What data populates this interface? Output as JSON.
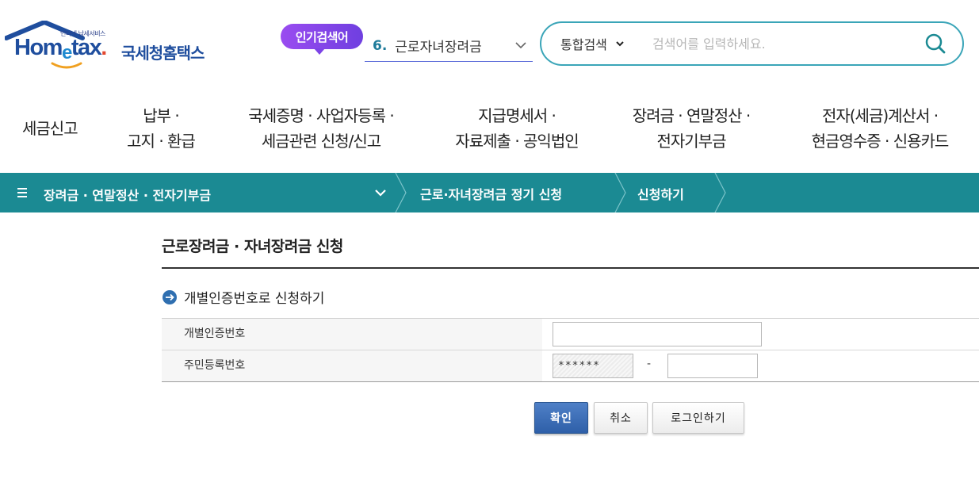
{
  "header": {
    "logo": {
      "tagline": "인터넷 납세서비스",
      "brand_prefix": "Hom",
      "brand_e": "e",
      "brand_suffix": "tax",
      "brand_dot": ".",
      "agency": "국세청홈택스"
    },
    "popular_badge": "인기검색어",
    "popular_rank": {
      "number": "6.",
      "term": "근로자녀장려금"
    },
    "search": {
      "scope": "통합검색",
      "placeholder": "검색어를 입력하세요."
    }
  },
  "gnb": [
    {
      "line1": "세금신고",
      "line2": ""
    },
    {
      "line1": "납부 ·",
      "line2": "고지 · 환급"
    },
    {
      "line1": "국세증명 · 사업자등록 ·",
      "line2": "세금관련 신청/신고"
    },
    {
      "line1": "지급명세서 ·",
      "line2": "자료제출 · 공익법인"
    },
    {
      "line1": "장려금 · 연말정산 ·",
      "line2": "전자기부금"
    },
    {
      "line1": "전자(세금)계산서 ·",
      "line2": "현금영수증 · 신용카드"
    }
  ],
  "breadcrumb": {
    "level1": "장려금 · 연말정산 · 전자기부금",
    "level2": "근로·자녀장려금 정기 신청",
    "level3": "신청하기"
  },
  "main": {
    "page_title": "근로장려금 · 자녀장려금 신청",
    "section_title": "개별인증번호로 신청하기",
    "form": {
      "auth_label": "개별인증번호",
      "auth_value": "",
      "rrn_label": "주민등록번호",
      "rrn_front_masked": "******",
      "rrn_separator": "-",
      "rrn_back_value": ""
    },
    "buttons": {
      "confirm": "확인",
      "cancel": "취소",
      "login": "로그인하기"
    }
  },
  "colors": {
    "brand_blue": "#1f4e9e",
    "teal_bar": "#1b8a93",
    "search_border": "#3aa5b8",
    "badge_purple": "#7d44e6",
    "primary_button": "#3a6db8"
  }
}
